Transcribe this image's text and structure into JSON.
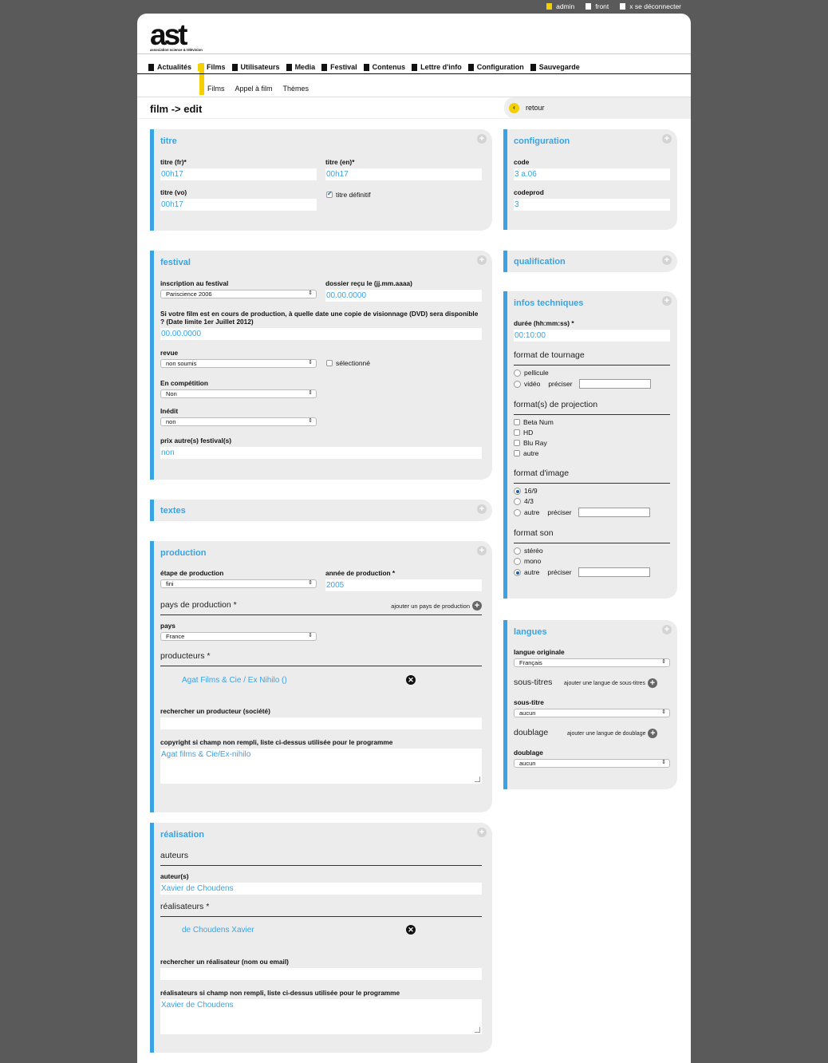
{
  "topbar": {
    "admin": "admin",
    "front": "front",
    "logout": "x se déconnecter"
  },
  "logo": {
    "text": "ast",
    "subtitle": "association science & télévision"
  },
  "nav": {
    "items": [
      "Actualités",
      "Films",
      "Utilisateurs",
      "Media",
      "Festival",
      "Contenus",
      "Lettre d'info",
      "Configuration",
      "Sauvegarde"
    ],
    "active": "Films",
    "subitems": [
      "Films",
      "Appel à film",
      "Thèmes"
    ]
  },
  "page": {
    "title": "film -> edit",
    "back_label": "retour"
  },
  "titre": {
    "title": "titre",
    "titre_fr_label": "titre (fr)*",
    "titre_fr": "00h17",
    "titre_en_label": "titre (en)*",
    "titre_en": "00h17",
    "titre_vo_label": "titre (vo)",
    "titre_vo": "00h17",
    "definitif_label": "titre définitif",
    "definitif_checked": true
  },
  "festival": {
    "title": "festival",
    "inscription_label": "inscription au festival",
    "inscription": "Pariscience 2006",
    "dossier_label": "dossier reçu le (jj.mm.aaaa)",
    "dossier": "00.00.0000",
    "copie_label": "Si votre film est en cours de production, à quelle date une copie de visionnage (DVD) sera disponible ? (Date limite 1er Juillet 2012)",
    "copie": "00.00.0000",
    "revue_label": "revue",
    "revue": "non soumis",
    "selectionne_label": "sélectionné",
    "competition_label": "En compétition",
    "competition": "Non",
    "inedit_label": "Inédit",
    "inedit": "non",
    "prix_label": "prix autre(s) festival(s)",
    "prix": "non"
  },
  "textes": {
    "title": "textes"
  },
  "production": {
    "title": "production",
    "etape_label": "étape de production",
    "etape": "fini",
    "annee_label": "année de production *",
    "annee": "2005",
    "pays_heading": "pays de production *",
    "add_pays": "ajouter un pays de production",
    "pays_label": "pays",
    "pays": "France",
    "producteurs_heading": "producteurs *",
    "producteur_entry": "Agat Films & Cie / Ex Nihilo ()",
    "search_label": "rechercher un producteur (société)",
    "search_value": "",
    "copyright_label": "copyright si champ non rempli, liste ci-dessus utilisée pour le programme",
    "copyright": "Agat films & Cie/Ex-nihilo"
  },
  "realisation": {
    "title": "réalisation",
    "auteurs_heading": "auteurs",
    "auteur_label": "auteur(s)",
    "auteur": "Xavier de Choudens",
    "realisateurs_heading": "réalisateurs *",
    "realisateur_entry": "de Choudens Xavier",
    "search_label": "rechercher un réalisateur (nom ou email)",
    "search_value": "",
    "realisateurs_label": "réalisateurs si champ non rempli, liste ci-dessus utilisée pour le programme",
    "realisateurs": "Xavier de Choudens"
  },
  "configuration": {
    "title": "configuration",
    "code_label": "code",
    "code": "3 a.06",
    "codeprod_label": "codeprod",
    "codeprod": "3"
  },
  "qualification": {
    "title": "qualification"
  },
  "infos": {
    "title": "infos techniques",
    "duree_label": "durée (hh:mm:ss) *",
    "duree": "00:10:00",
    "tournage_heading": "format de tournage",
    "tournage_options": [
      "pellicule",
      "vidéo"
    ],
    "preciser": "préciser",
    "projection_heading": "format(s) de projection",
    "projection_options": [
      "Beta Num",
      "HD",
      "Blu Ray",
      "autre"
    ],
    "image_heading": "format d'image",
    "image_options": [
      "16/9",
      "4/3",
      "autre"
    ],
    "image_selected": "16/9",
    "son_heading": "format son",
    "son_options": [
      "stéréo",
      "mono",
      "autre"
    ],
    "son_selected": "autre"
  },
  "langues": {
    "title": "langues",
    "originale_label": "langue originale",
    "originale": "Français",
    "soustitres_heading": "sous-titres",
    "add_soustitre": "ajouter une langue de sous-titres",
    "soustitre_label": "sous-titre",
    "soustitre": "aucun",
    "doublage_heading": "doublage",
    "add_doublage": "ajouter une langue de doublage",
    "doublage_label": "doublage",
    "doublage": "aucun"
  },
  "colors": {
    "accent": "#3aa3e3",
    "highlight": "#f4d000",
    "background": "#5a5a5a"
  }
}
